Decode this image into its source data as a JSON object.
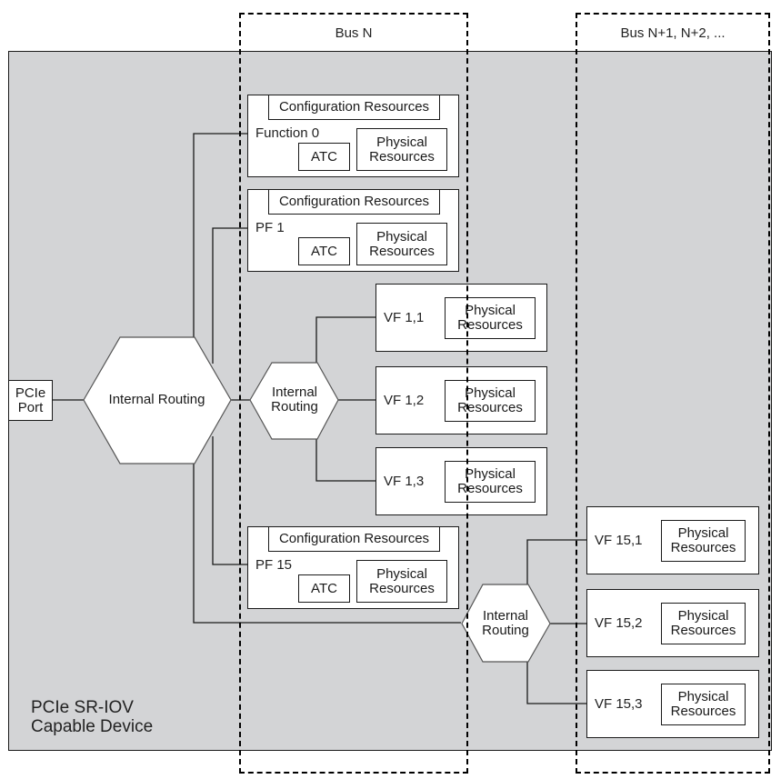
{
  "diagram": {
    "device_label": "PCIe SR-IOV\nCapable Device",
    "device_label_lines": [
      "PCIe SR-IOV",
      "Capable Device"
    ],
    "bus_regions": [
      {
        "label": "Bus N"
      },
      {
        "label": "Bus N+1, N+2, ..."
      }
    ],
    "port": {
      "lines": [
        "PCIe",
        "Port"
      ]
    },
    "routers": [
      {
        "id": "main",
        "lines": [
          "Internal Routing"
        ]
      },
      {
        "id": "pf1",
        "lines": [
          "Internal",
          "Routing"
        ]
      },
      {
        "id": "pf15",
        "lines": [
          "Internal",
          "Routing"
        ]
      }
    ],
    "physical_functions": [
      {
        "name": "Function 0",
        "config": "Configuration Resources",
        "atc": "ATC",
        "physical": [
          "Physical",
          "Resources"
        ]
      },
      {
        "name": "PF 1",
        "config": "Configuration Resources",
        "atc": "ATC",
        "physical": [
          "Physical",
          "Resources"
        ]
      },
      {
        "name": "PF 15",
        "config": "Configuration Resources",
        "atc": "ATC",
        "physical": [
          "Physical",
          "Resources"
        ]
      }
    ],
    "virtual_functions": [
      {
        "name": "VF 1,1",
        "physical": [
          "Physical",
          "Resources"
        ]
      },
      {
        "name": "VF 1,2",
        "physical": [
          "Physical",
          "Resources"
        ]
      },
      {
        "name": "VF 1,3",
        "physical": [
          "Physical",
          "Resources"
        ]
      },
      {
        "name": "VF 15,1",
        "physical": [
          "Physical",
          "Resources"
        ]
      },
      {
        "name": "VF 15,2",
        "physical": [
          "Physical",
          "Resources"
        ]
      },
      {
        "name": "VF 15,3",
        "physical": [
          "Physical",
          "Resources"
        ]
      }
    ],
    "colors": {
      "device_fill": "#d3d4d6",
      "line": "#1a1a1a",
      "box_fill": "#ffffff"
    }
  }
}
